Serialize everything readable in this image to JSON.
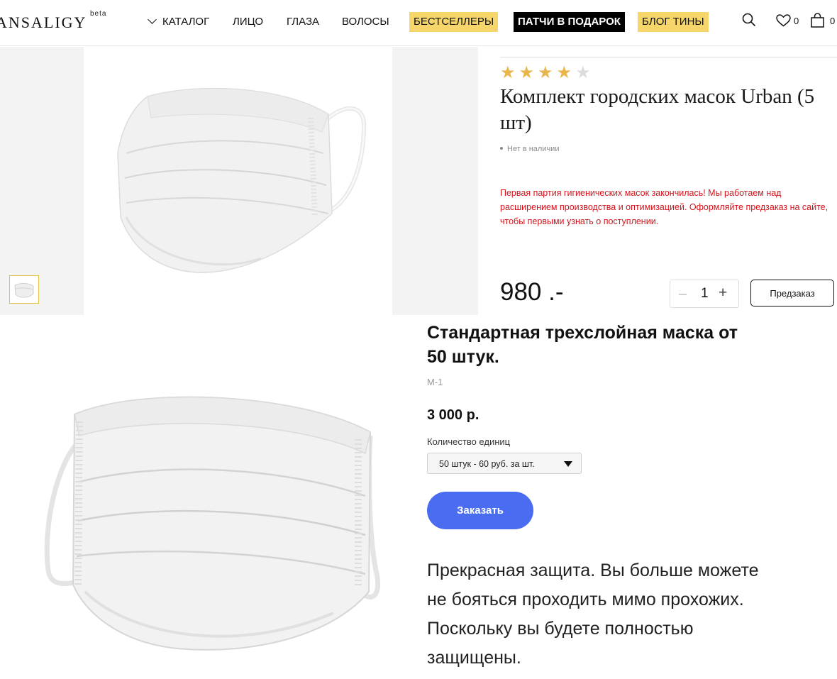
{
  "header": {
    "logo": "ANSALIGY",
    "logo_badge": "beta",
    "nav": [
      {
        "label": "КАТАЛОГ"
      },
      {
        "label": "ЛИЦО"
      },
      {
        "label": "ГЛАЗА"
      },
      {
        "label": "ВОЛОСЫ"
      },
      {
        "label": "БЕСТСЕЛЛЕРЫ"
      },
      {
        "label": "ПАТЧИ В ПОДАРОК"
      },
      {
        "label": "БЛОГ ТИНЫ"
      }
    ],
    "icons": {
      "search": "search-icon",
      "wishlist": "heart-icon",
      "cart": "bag-icon"
    },
    "wishlist_count": "0",
    "cart_count": "0"
  },
  "product": {
    "rating": 4,
    "rating_max": 5,
    "title": "Комплект городских масок Urban (5 шт)",
    "stock_status": "Нет в наличии",
    "notice": "Первая партия гигиенических масок закончилась! Мы работаем над расширением производства и оптимизацией. Оформляйте предзаказ на сайте, чтобы первыми узнать о поступлении.",
    "price": "980 .-",
    "quantity": "1",
    "preorder_label": "Предзаказ",
    "colors": {
      "notice": "#d4151c",
      "stars": "#e8b64a",
      "highlight": "#f6d66a"
    }
  },
  "offer": {
    "title": "Стандартная трехслойная маска от 50 штук.",
    "sku": "M-1",
    "price": "3 000 р.",
    "quantity_label": "Количество единиц",
    "quantity_selected": "50 штук - 60 руб. за шт.",
    "order_label": "Заказать",
    "description": "Прекрасная защита. Вы больше можете не бояться проходить мимо прохожих. Поскольку вы будете полностью защищены.",
    "colors": {
      "button": "#4a6cf0"
    }
  }
}
